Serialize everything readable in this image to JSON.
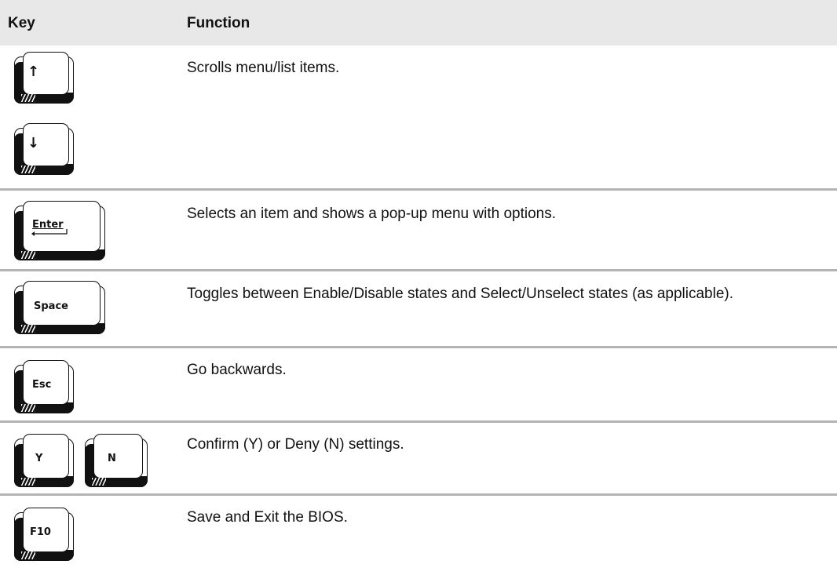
{
  "header": {
    "key_label": "Key",
    "function_label": "Function"
  },
  "rows": [
    {
      "keys": [
        "↑",
        "↓"
      ],
      "description": "Scrolls menu/list items."
    },
    {
      "keys": [
        "Enter"
      ],
      "description": "Selects an item and shows a pop-up menu with options."
    },
    {
      "keys": [
        "Space"
      ],
      "description": "Toggles between Enable/Disable states and Select/Unselect states (as applicable)."
    },
    {
      "keys": [
        "Esc"
      ],
      "description": "Go backwards."
    },
    {
      "keys": [
        "Y",
        "N"
      ],
      "description": "Confirm (Y) or Deny (N) settings."
    },
    {
      "keys": [
        "F10"
      ],
      "description": "Save and Exit the BIOS."
    }
  ],
  "colors": {
    "header_bg": "#e8e8e8",
    "rule": "#b4b4b4",
    "keycap_ink": "#111111"
  },
  "icons": {
    "return_arrow": "return-arrow-icon"
  }
}
